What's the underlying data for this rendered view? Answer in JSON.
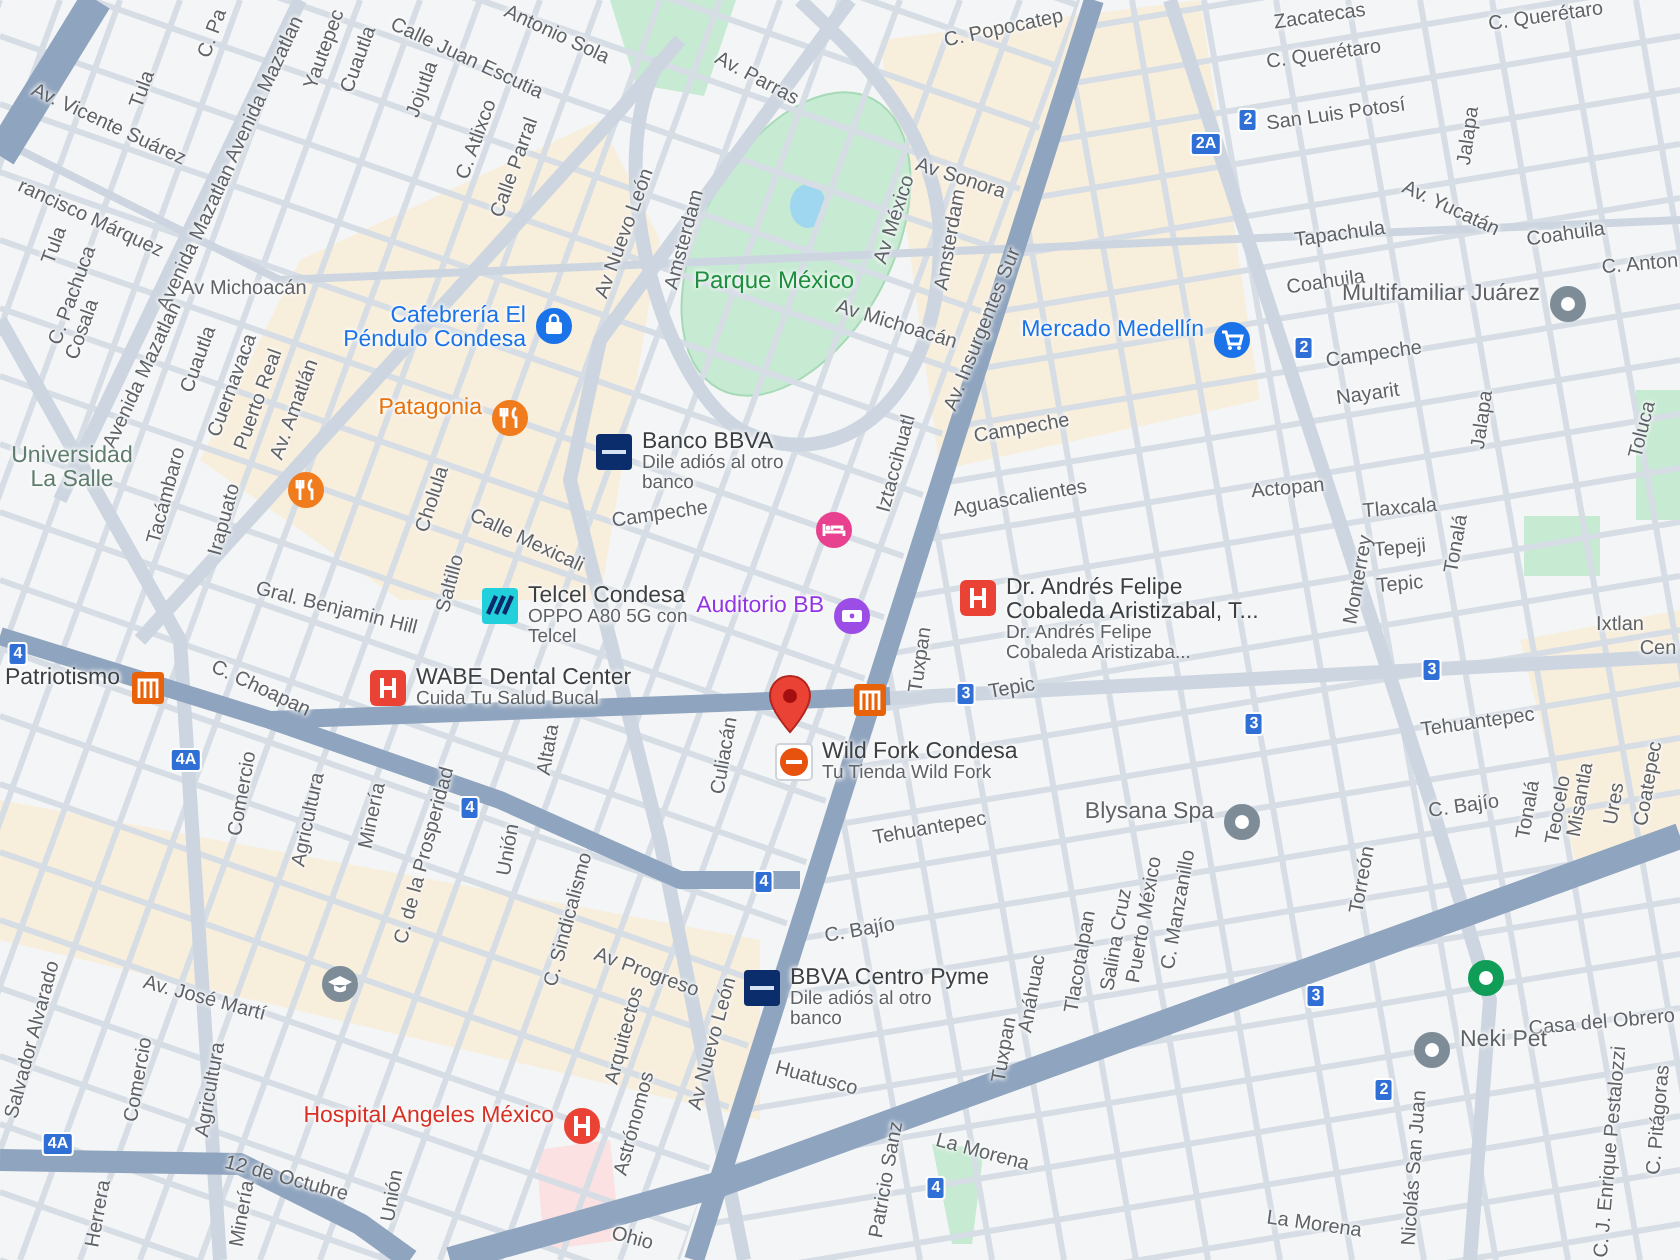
{
  "map": {
    "streets": [
      "C. Pa",
      "Tula",
      "Yautepec",
      "Cuautla",
      "Calle Juan Escutia",
      "Antonio Sola",
      "Av. Parras",
      "C. Popocatep",
      "Zacatecas",
      "C. Querétaro",
      "C. Querétaro",
      "Av. Vicente Suárez",
      "Avenida Mazatlan",
      "Jojutla",
      "C. Atlixco",
      "Calle Parral",
      "San Luis Potosí",
      "Jalapa",
      "Av Sonora",
      "Av. Yucatán",
      "rancisco Márquez",
      "Tula",
      "Avenida Mazatlan",
      "Av Nuevo León",
      "Amsterdam",
      "Av México",
      "Amsterdam",
      "Tapachula",
      "Coahuila",
      "Coahuila",
      "C. Anton",
      "Av Michoacán",
      "C. Pachuca",
      "Cosala",
      "Av Michoacán",
      "Av. Insurgentes Sur",
      "Campeche",
      "Nayarit",
      "Cuautla",
      "Cuernavaca",
      "Puerto Real",
      "Av. Amatlán",
      "Avenida Mazatlan",
      "Campeche",
      "Jalapa",
      "Toluca",
      "Tacámbaro",
      "Irapuato",
      "Cholula",
      "Campeche",
      "Iztaccihuatl",
      "Aguascalientes",
      "Actopan",
      "Tlaxcala",
      "Tonalá",
      "Tepeji",
      "Calle Mexicali",
      "Monterrey",
      "Tepic",
      "Saltillo",
      "Gral. Benjamin Hill",
      "Ixtlan",
      "Cen",
      "Tuxpan",
      "Tepic",
      "C. Choapan",
      "Altata",
      "Culiacán",
      "Tehuantepec",
      "Comercio",
      "Agricultura",
      "Minería",
      "C. de la Prosperidad",
      "Unión",
      "C. Sindicalismo",
      "Tehuantepec",
      "C. Bajío",
      "Tonalá",
      "Teocelo",
      "Misantla",
      "Ures",
      "Coatepec",
      "Torreón",
      "C. Bajío",
      "C. Manzanillo",
      "Puerto México",
      "Salina Cruz",
      "Tlacotalpan",
      "Av. José Martí",
      "Av Progreso",
      "Salvador Alvarado",
      "Arquitectos",
      "Av Nuevo León",
      "Anáhuac",
      "Tuxpan",
      "Casa del Obrero",
      "Comercio",
      "Agricultura",
      "Huatusco",
      "Astrónomos",
      "C. J. Enrique Pestalozzi",
      "C. Pitágoras",
      "La Morena",
      "12 de Octubre",
      "Unión",
      "Nicolás San Juan",
      "Patricio Sanz",
      "La Morena",
      "Ohio",
      "Minería",
      "Herrera"
    ],
    "parks": [
      "Parque México"
    ],
    "route_shields": [
      "4",
      "2",
      "2A",
      "2",
      "3",
      "3",
      "3",
      "4A",
      "4",
      "4",
      "3",
      "2",
      "4A",
      "4"
    ],
    "places": [
      {
        "kind": "shopping",
        "name": "Cafebrería El Péndulo Condesa"
      },
      {
        "kind": "restaurant",
        "name": "Patagonia"
      },
      {
        "kind": "restaurant"
      },
      {
        "kind": "bank",
        "name": "Banco BBVA",
        "subtitle": "Dile adiós al otro banco"
      },
      {
        "kind": "hotel"
      },
      {
        "kind": "telecom",
        "name": "Telcel Condesa",
        "subtitle": "OPPO A80 5G con Telcel"
      },
      {
        "kind": "event",
        "name": "Auditorio BB"
      },
      {
        "kind": "clinic",
        "name": "Dr. Andrés Felipe Cobaleda Aristizabal, T...",
        "subtitle": "Dr. Andrés Felipe Cobaleda Aristizaba..."
      },
      {
        "kind": "metro",
        "name": "Patriotismo"
      },
      {
        "kind": "clinic",
        "name": "WABE Dental Center",
        "subtitle": "Cuida Tu Salud Bucal"
      },
      {
        "kind": "metro"
      },
      {
        "kind": "store",
        "name": "Wild Fork Condesa",
        "subtitle": "Tu Tienda Wild Fork"
      },
      {
        "kind": "pin",
        "name": "Blysana Spa"
      },
      {
        "kind": "education"
      },
      {
        "kind": "green-pin"
      },
      {
        "kind": "bank",
        "name": "BBVA Centro Pyme",
        "subtitle": "Dile adiós al otro banco"
      },
      {
        "kind": "pin",
        "name": "Neki Pet"
      },
      {
        "kind": "hospital",
        "name": "Hospital Angeles México"
      },
      {
        "kind": "pin",
        "name": "Multifamiliar Juárez"
      },
      {
        "kind": "market",
        "name": "Mercado Medellín"
      },
      {
        "kind": "campus",
        "name": "Universidad La Salle"
      }
    ]
  }
}
